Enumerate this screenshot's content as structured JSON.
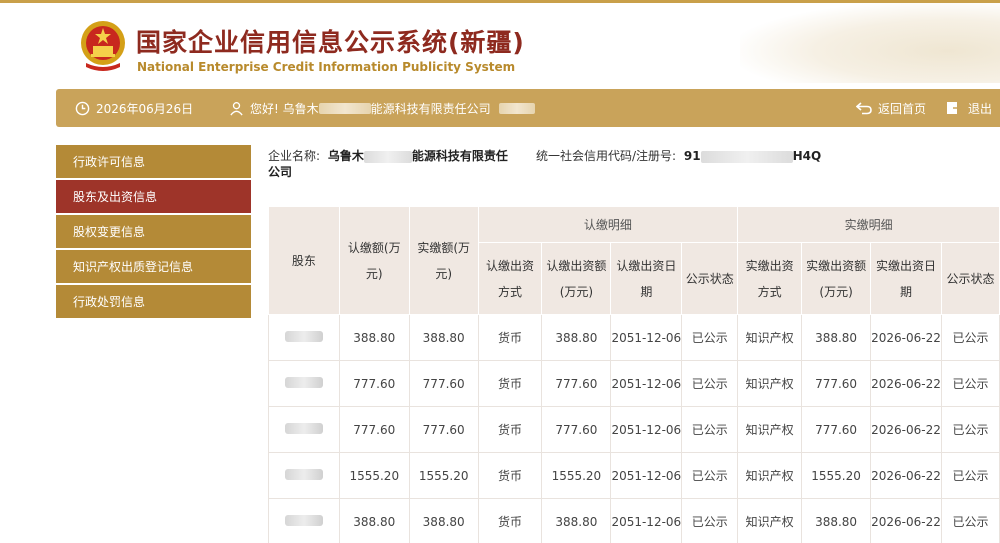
{
  "header": {
    "title_cn": "国家企业信用信息公示系统(新疆)",
    "title_en": "National Enterprise Credit Information Publicity System"
  },
  "infobar": {
    "date": "2026年06月26日",
    "greeting": "您好! 乌鲁木",
    "company_suffix": "能源科技有限责任公司",
    "return_home": "返回首页",
    "logout": "退出"
  },
  "sidebar": {
    "items": [
      {
        "label": "行政许可信息",
        "active": false
      },
      {
        "label": "股东及出资信息",
        "active": true
      },
      {
        "label": "股权变更信息",
        "active": false
      },
      {
        "label": "知识产权出质登记信息",
        "active": false
      },
      {
        "label": "行政处罚信息",
        "active": false
      }
    ]
  },
  "company": {
    "name_label": "企业名称:",
    "name_prefix": "乌鲁木",
    "name_suffix": "能源科技有限责任",
    "name_line2": "公司",
    "code_label": "统一社会信用代码/注册号:",
    "code_prefix": "91",
    "code_suffix": "H4Q"
  },
  "table": {
    "col_holder": "股东",
    "col_subscribed": "认缴额(万元)",
    "col_paid": "实缴额(万元)",
    "group_subscribed": "认缴明细",
    "group_paid": "实缴明细",
    "sub_method": "认缴出资方式",
    "sub_amount": "认缴出资额(万元)",
    "sub_date": "认缴出资日期",
    "sub_status": "公示状态",
    "paid_method": "实缴出资方式",
    "paid_amount": "实缴出资额(万元)",
    "paid_date": "实缴出资日期",
    "paid_status": "公示状态",
    "rows": [
      {
        "subscribed": "388.80",
        "paid": "388.80",
        "s_method": "货币",
        "s_amount": "388.80",
        "s_date": "2051-12-06",
        "s_status": "已公示",
        "p_method": "知识产权",
        "p_amount": "388.80",
        "p_date": "2026-06-22",
        "p_status": "已公示"
      },
      {
        "subscribed": "777.60",
        "paid": "777.60",
        "s_method": "货币",
        "s_amount": "777.60",
        "s_date": "2051-12-06",
        "s_status": "已公示",
        "p_method": "知识产权",
        "p_amount": "777.60",
        "p_date": "2026-06-22",
        "p_status": "已公示"
      },
      {
        "subscribed": "777.60",
        "paid": "777.60",
        "s_method": "货币",
        "s_amount": "777.60",
        "s_date": "2051-12-06",
        "s_status": "已公示",
        "p_method": "知识产权",
        "p_amount": "777.60",
        "p_date": "2026-06-22",
        "p_status": "已公示"
      },
      {
        "subscribed": "1555.20",
        "paid": "1555.20",
        "s_method": "货币",
        "s_amount": "1555.20",
        "s_date": "2051-12-06",
        "s_status": "已公示",
        "p_method": "知识产权",
        "p_amount": "1555.20",
        "p_date": "2026-06-22",
        "p_status": "已公示"
      },
      {
        "subscribed": "388.80",
        "paid": "388.80",
        "s_method": "货币",
        "s_amount": "388.80",
        "s_date": "2051-12-06",
        "s_status": "已公示",
        "p_method": "知识产权",
        "p_amount": "388.80",
        "p_date": "2026-06-22",
        "p_status": "已公示"
      }
    ]
  },
  "colors": {
    "gold": "#c9a35a",
    "sidebar_gold": "#b48a37",
    "active_red": "#9e3429",
    "title_red": "#8e2a1f",
    "header_cell": "#f0e8e2"
  },
  "icons": {
    "emblem": "national-emblem-icon",
    "clock": "clock-icon",
    "user": "user-icon",
    "return": "return-icon",
    "logout": "logout-icon"
  }
}
